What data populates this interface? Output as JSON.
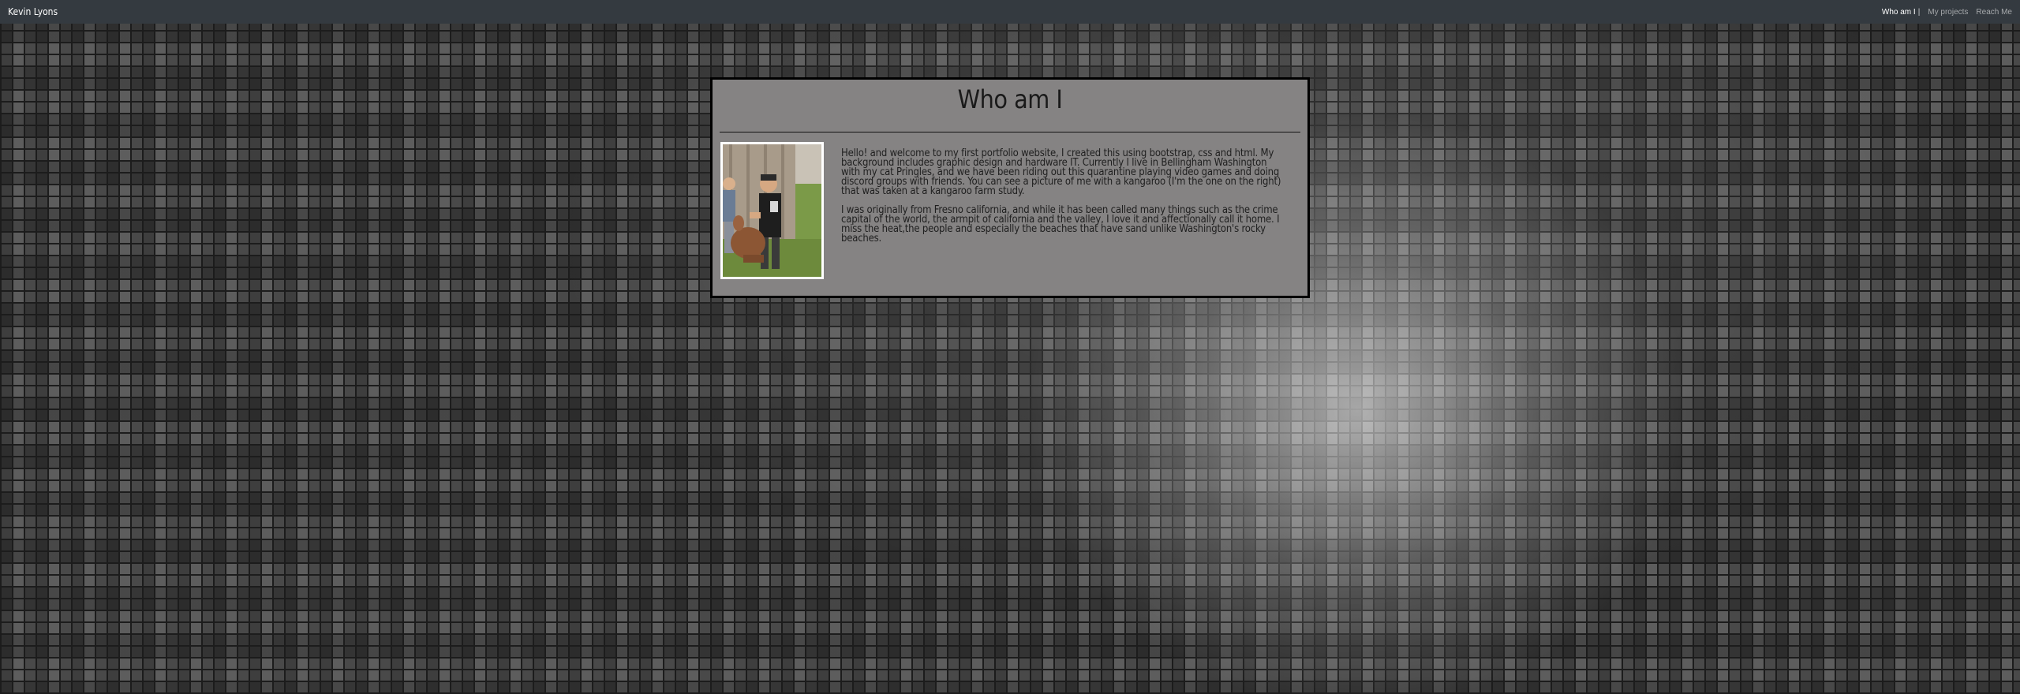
{
  "navbar": {
    "brand": "Kevin Lyons",
    "links": [
      {
        "label": "Who am I",
        "active": true,
        "current_mark": "|"
      },
      {
        "label": "My projects",
        "active": false
      },
      {
        "label": "Reach Me",
        "active": false
      }
    ]
  },
  "card": {
    "title": "Who am I",
    "photo_icon": "portrait-photo",
    "paragraphs": [
      "Hello! and welcome to my first portfolio website, I created this using bootstrap, css and html. My background includes graphic design and hardware IT. Currently I live in Bellingham Washington with my cat Pringles, and we have been riding out this quarantine playing video games and doing discord groups with friends. You can see a picture of me with a kangaroo (I'm the one on the right) that was taken at a kangaroo farm study.",
      "I was originally from Fresno california, and while it has been called many things such as the crime capital of the world, the armpit of california and the valley, I love it and affectionally call it home. I miss the heat,the people and especially the beaches that have sand unlike Washington's rocky beaches."
    ]
  },
  "colors": {
    "navbar_bg": "#343a40",
    "card_bg": "#858383",
    "card_border": "#000000"
  }
}
